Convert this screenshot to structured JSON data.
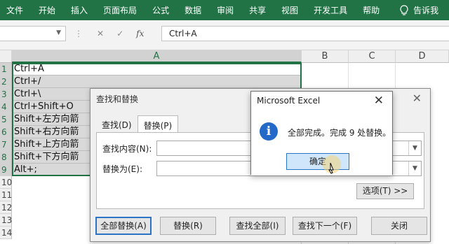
{
  "ribbon": {
    "tabs": [
      "文件",
      "开始",
      "插入",
      "页面布局",
      "公式",
      "数据",
      "审阅",
      "共享",
      "视图",
      "开发工具",
      "帮助"
    ],
    "tell_me": "告诉我",
    "icon": "lightbulb-icon",
    "color": "#217346"
  },
  "formula_bar": {
    "name_box": "",
    "cancel_icon": "cancel-icon",
    "enter_icon": "check-icon",
    "fx_label": "fx",
    "content": "Ctrl+A"
  },
  "sheet": {
    "columns": [
      "A",
      "B",
      "C",
      "D"
    ],
    "rows": [
      "1",
      "2",
      "3",
      "4",
      "5",
      "6",
      "7",
      "8",
      "9",
      "10",
      "11",
      "12",
      "13",
      "14"
    ],
    "cells_a": [
      "Ctrl+A",
      "Ctrl+/",
      "Ctrl+\\",
      "Ctrl+Shift+O",
      "Shift+左方向箭",
      "Shift+右方向箭",
      "Shift+上方向箭",
      "Shift+下方向箭",
      "Alt+;"
    ]
  },
  "find_replace": {
    "title": "查找和替换",
    "close": "✕",
    "tabs": [
      "查找(D)",
      "替换(P)"
    ],
    "find_label": "查找内容(N):",
    "replace_label": "替换为(E):",
    "find_value": "",
    "replace_value": "",
    "options_button": "选项(T) >>",
    "buttons": [
      "全部替换(A)",
      "替换(R)",
      "查找全部(I)",
      "查找下一个(F)",
      "关闭"
    ]
  },
  "message_box": {
    "title": "Microsoft Excel",
    "close": "✕",
    "icon": "info-icon",
    "icon_glyph": "i",
    "message": "全部完成。完成 9 处替换。",
    "ok_button": "确定"
  }
}
